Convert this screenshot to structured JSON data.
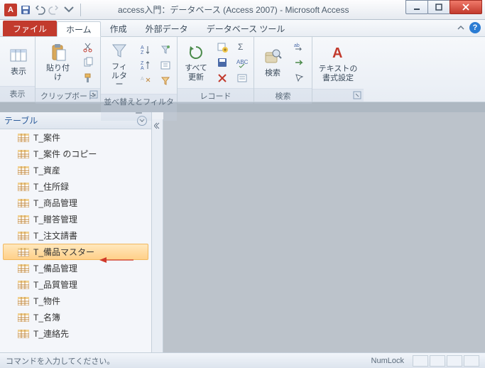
{
  "title": "access入門：データベース (Access 2007) - Microsoft Access",
  "app_badge": "A",
  "file_tab": "ファイル",
  "tabs": [
    "ホーム",
    "作成",
    "外部データ",
    "データベース ツール"
  ],
  "active_tab": 0,
  "ribbon": {
    "display": {
      "label": "表示",
      "group": "表示"
    },
    "clipboard": {
      "paste": "貼り付け",
      "group": "クリップボード"
    },
    "sort": {
      "filter": "フィルター",
      "group": "並べ替えとフィルター"
    },
    "records": {
      "refresh": "すべて\n更新",
      "group": "レコード"
    },
    "find": {
      "find": "検索",
      "group": "検索"
    },
    "text": {
      "format": "テキストの\n書式設定",
      "group": ""
    }
  },
  "nav": {
    "header": "テーブル",
    "items": [
      "T_案件",
      "T_案件 のコピー",
      "T_資産",
      "T_住所録",
      "T_商品管理",
      "T_贈答管理",
      "T_注文請書",
      "T_備品マスター",
      "T_備品管理",
      "T_品質管理",
      "T_物件",
      "T_名簿",
      "T_連絡先"
    ],
    "selected_index": 7
  },
  "status": {
    "prompt": "コマンドを入力してください。",
    "numlock": "NumLock"
  }
}
